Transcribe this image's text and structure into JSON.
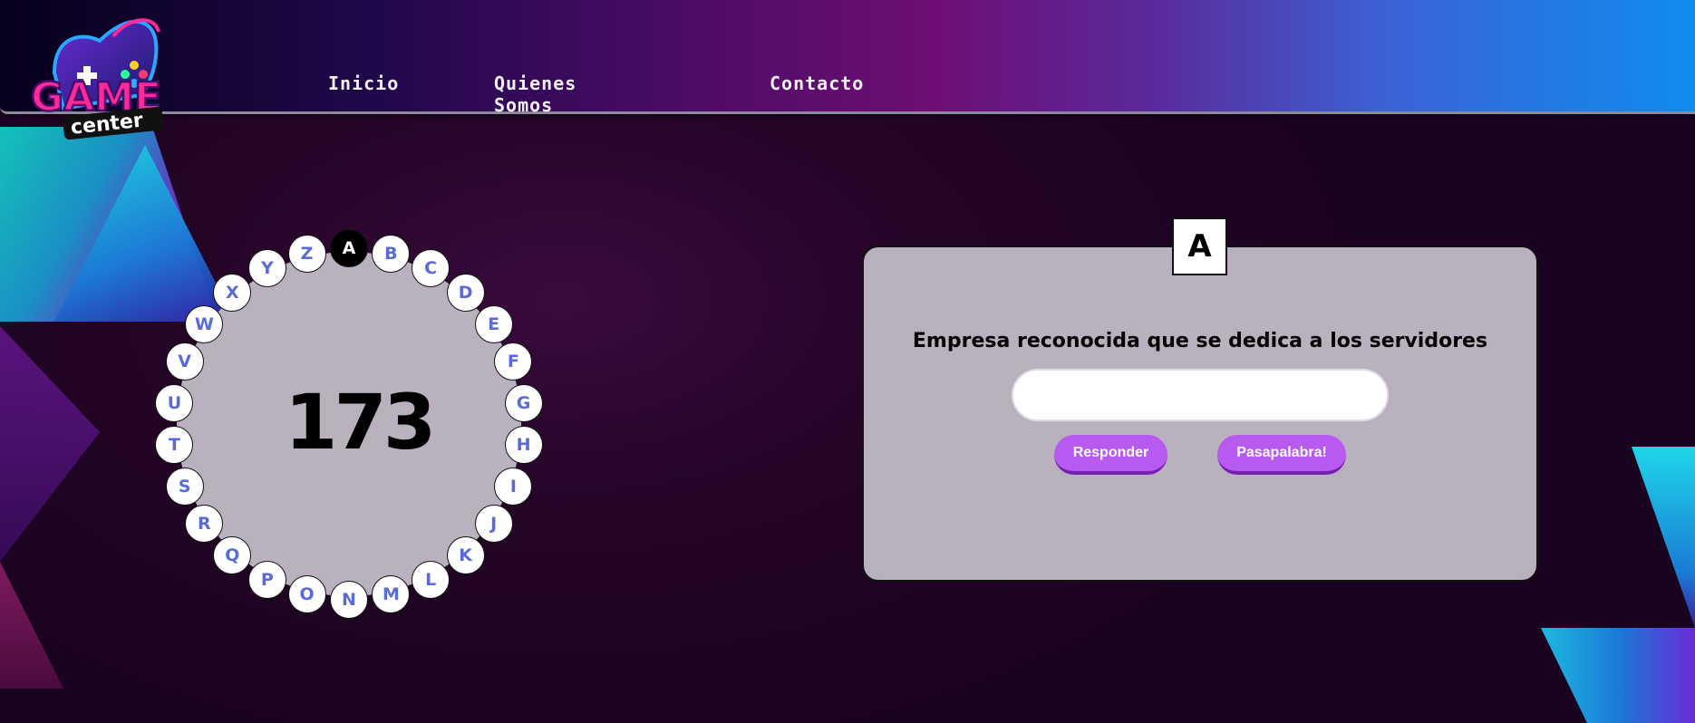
{
  "header": {
    "logo": {
      "text_top": "GAME",
      "text_bottom": "center"
    },
    "nav": [
      {
        "label": "Inicio"
      },
      {
        "label": "Quienes Somos"
      },
      {
        "label": "Contacto"
      }
    ]
  },
  "rosco": {
    "score": "173",
    "active_letter": "A",
    "letters": [
      "A",
      "B",
      "C",
      "D",
      "E",
      "F",
      "G",
      "H",
      "I",
      "J",
      "K",
      "L",
      "M",
      "N",
      "O",
      "P",
      "Q",
      "R",
      "S",
      "T",
      "U",
      "V",
      "W",
      "X",
      "Y",
      "Z"
    ]
  },
  "question_card": {
    "letter": "A",
    "question": "Empresa reconocida que se dedica a los servidores",
    "answer_value": "",
    "respond_label": "Responder",
    "pass_label": "Pasapalabra!"
  },
  "colors": {
    "accent_button": "#b85af0",
    "letter_text": "#5a6ad6",
    "panel_bg": "#bab1bf"
  }
}
